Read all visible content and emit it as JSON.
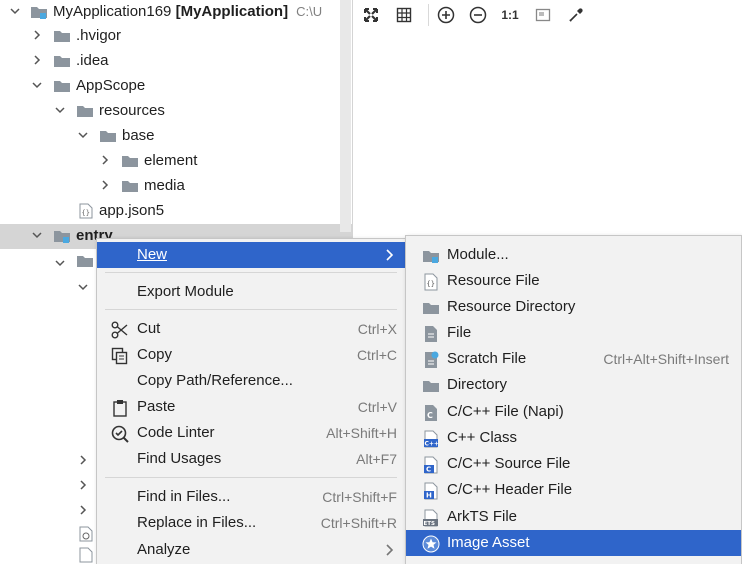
{
  "project_tree": {
    "root": {
      "name": "MyApplication169",
      "module": "[MyApplication]",
      "path": "C:\\U"
    },
    "items": [
      {
        "label": ".hvigor"
      },
      {
        "label": ".idea"
      },
      {
        "label": "AppScope"
      },
      {
        "label": "resources"
      },
      {
        "label": "base"
      },
      {
        "label": "element"
      },
      {
        "label": "media"
      },
      {
        "label": "app.json5"
      },
      {
        "label": "entry"
      }
    ]
  },
  "toolbar": {
    "actual_size_label": "1:1"
  },
  "context_menu": {
    "items": [
      {
        "label": "New",
        "shortcut": ""
      },
      {
        "label": "Export Module",
        "shortcut": ""
      },
      {
        "label": "Cut",
        "shortcut": "Ctrl+X"
      },
      {
        "label": "Copy",
        "shortcut": "Ctrl+C"
      },
      {
        "label": "Copy Path/Reference...",
        "shortcut": ""
      },
      {
        "label": "Paste",
        "shortcut": "Ctrl+V"
      },
      {
        "label": "Code Linter",
        "shortcut": "Alt+Shift+H"
      },
      {
        "label": "Find Usages",
        "shortcut": "Alt+F7"
      },
      {
        "label": "Find in Files...",
        "shortcut": "Ctrl+Shift+F"
      },
      {
        "label": "Replace in Files...",
        "shortcut": "Ctrl+Shift+R"
      },
      {
        "label": "Analyze",
        "shortcut": ""
      }
    ]
  },
  "new_submenu": {
    "items": [
      {
        "label": "Module...",
        "shortcut": ""
      },
      {
        "label": "Resource File",
        "shortcut": ""
      },
      {
        "label": "Resource Directory",
        "shortcut": ""
      },
      {
        "label": "File",
        "shortcut": ""
      },
      {
        "label": "Scratch File",
        "shortcut": "Ctrl+Alt+Shift+Insert"
      },
      {
        "label": "Directory",
        "shortcut": ""
      },
      {
        "label": "C/C++ File (Napi)",
        "shortcut": ""
      },
      {
        "label": "C++ Class",
        "shortcut": ""
      },
      {
        "label": "C/C++ Source File",
        "shortcut": ""
      },
      {
        "label": "C/C++ Header File",
        "shortcut": ""
      },
      {
        "label": "ArkTS File",
        "shortcut": ""
      },
      {
        "label": "Image Asset",
        "shortcut": ""
      }
    ]
  },
  "colors": {
    "highlight": "#2f65ca",
    "folder": "#8c959e",
    "module_badge": "#4aa8e0"
  }
}
